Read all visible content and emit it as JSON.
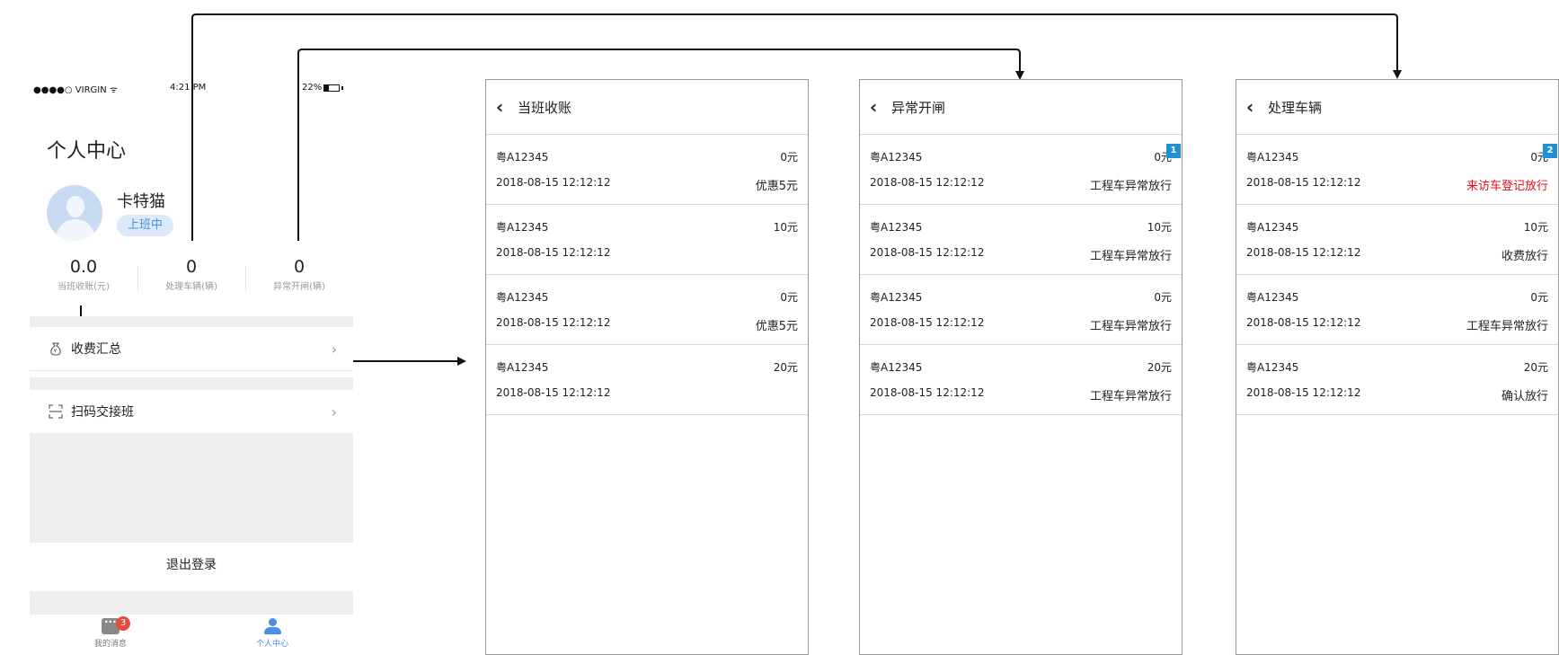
{
  "status_bar": {
    "carrier": "●●●●○ VIRGIN ᯤ",
    "time": "4:21 PM",
    "battery": "22%"
  },
  "profile": {
    "page_title": "个人中心",
    "username": "卡特猫",
    "duty_status": "上班中",
    "stats": [
      {
        "value": "0.0",
        "label": "当班收账(元)"
      },
      {
        "value": "0",
        "label": "处理车辆(辆)"
      },
      {
        "value": "0",
        "label": "异常开闸(辆)"
      }
    ],
    "menu": [
      {
        "label": "收费汇总",
        "icon": "money-bag-icon"
      },
      {
        "label": "扫码交接班",
        "icon": "scan-icon"
      }
    ],
    "logout_label": "退出登录",
    "tabs": [
      {
        "label": "我的消息",
        "icon": "message-icon",
        "badge": "3"
      },
      {
        "label": "个人中心",
        "icon": "user-icon",
        "active": true
      }
    ]
  },
  "screens": [
    {
      "title": "当班收账",
      "records": [
        {
          "plate": "粤A12345",
          "amount": "0元",
          "time": "2018-08-15 12:12:12",
          "note": "优惠5元"
        },
        {
          "plate": "粤A12345",
          "amount": "10元",
          "time": "2018-08-15 12:12:12",
          "note": ""
        },
        {
          "plate": "粤A12345",
          "amount": "0元",
          "time": "2018-08-15 12:12:12",
          "note": "优惠5元"
        },
        {
          "plate": "粤A12345",
          "amount": "20元",
          "time": "2018-08-15 12:12:12",
          "note": ""
        }
      ]
    },
    {
      "title": "异常开闸",
      "badge": "1",
      "records": [
        {
          "plate": "粤A12345",
          "amount": "0元",
          "time": "2018-08-15 12:12:12",
          "note": "工程车异常放行"
        },
        {
          "plate": "粤A12345",
          "amount": "10元",
          "time": "2018-08-15 12:12:12",
          "note": "工程车异常放行"
        },
        {
          "plate": "粤A12345",
          "amount": "0元",
          "time": "2018-08-15 12:12:12",
          "note": "工程车异常放行"
        },
        {
          "plate": "粤A12345",
          "amount": "20元",
          "time": "2018-08-15 12:12:12",
          "note": "工程车异常放行"
        }
      ]
    },
    {
      "title": "处理车辆",
      "badge": "2",
      "records": [
        {
          "plate": "粤A12345",
          "amount": "0元",
          "time": "2018-08-15 12:12:12",
          "note": "来访车登记放行",
          "note_color": "#e8101a"
        },
        {
          "plate": "粤A12345",
          "amount": "10元",
          "time": "2018-08-15 12:12:12",
          "note": "收费放行"
        },
        {
          "plate": "粤A12345",
          "amount": "0元",
          "time": "2018-08-15 12:12:12",
          "note": "工程车异常放行"
        },
        {
          "plate": "粤A12345",
          "amount": "20元",
          "time": "2018-08-15 12:12:12",
          "note": "确认放行"
        }
      ]
    }
  ]
}
